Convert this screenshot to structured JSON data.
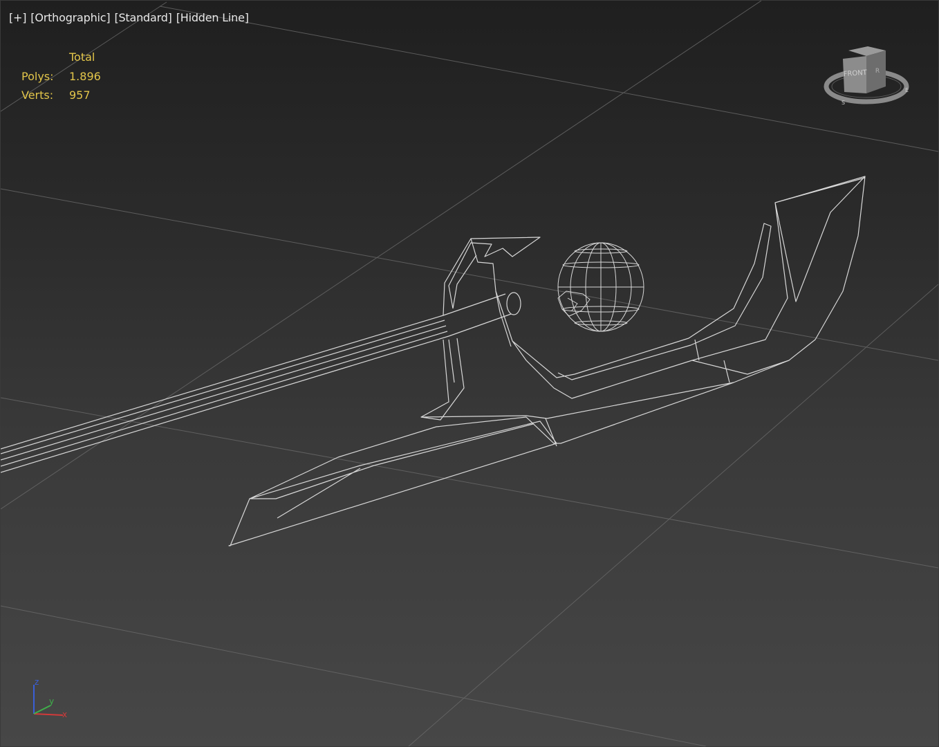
{
  "viewport": {
    "labels": [
      "[+]",
      "[Orthographic]",
      "[Standard]",
      "[Hidden Line]"
    ]
  },
  "stats": {
    "header": "Total",
    "polys_label": "Polys:",
    "polys_value": "1.896",
    "verts_label": "Verts:",
    "verts_value": "957"
  },
  "viewcube": {
    "face_label": "FRONT",
    "side_label": "R"
  },
  "axes": {
    "x": "x",
    "y": "y",
    "z": "z"
  },
  "colors": {
    "stats_text": "#e3c64a",
    "wire": "#d8d8d8",
    "grid": "#6a6a6a",
    "axis_x": "#d23a3a",
    "axis_y": "#3fb04a",
    "axis_z": "#3a5fd8"
  }
}
